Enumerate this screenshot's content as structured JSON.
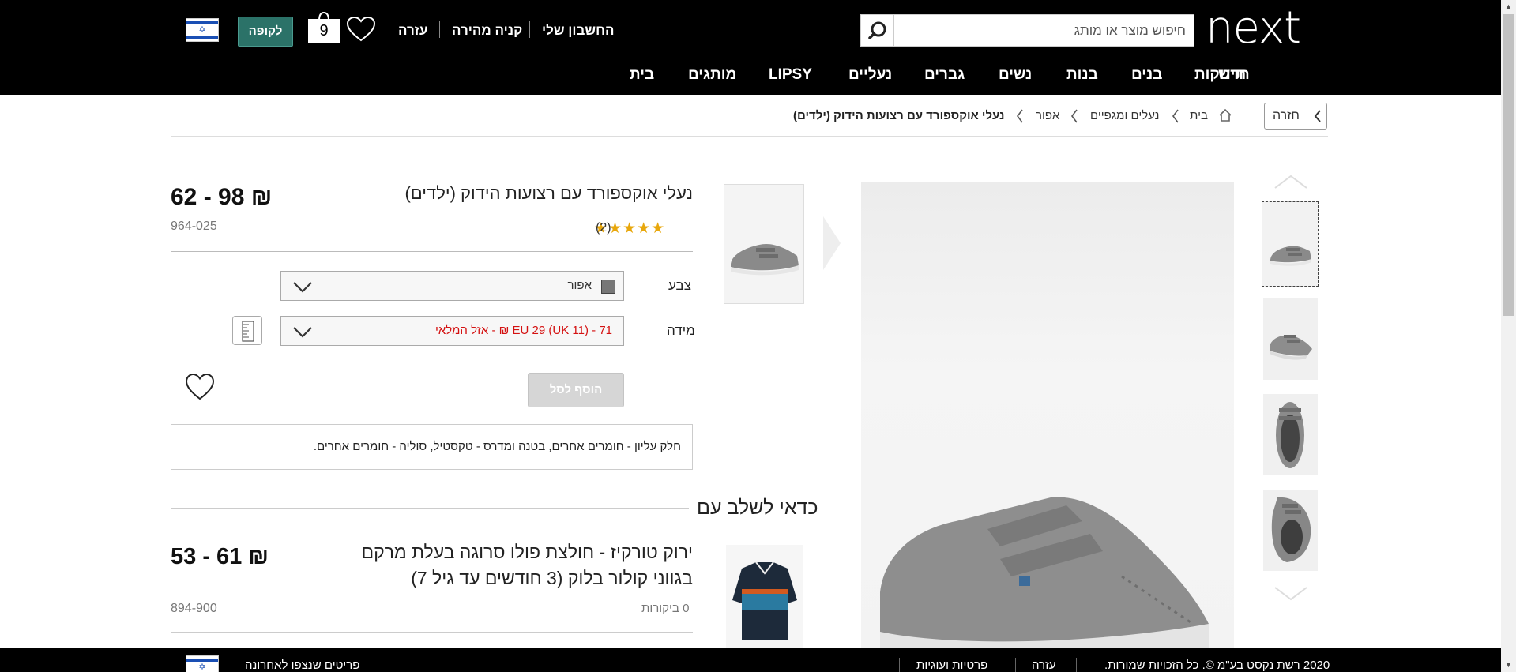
{
  "header": {
    "logo": "next",
    "search_placeholder": "חיפוש מוצר או מותג",
    "my_account": "החשבון שלי",
    "quick_buy": "קניה מהירה",
    "help": "עזרה",
    "bag_count": "9",
    "checkout": "לקופה",
    "flag_icon": "israel-flag-icon"
  },
  "nav": [
    "חדש",
    "תינוקות",
    "בנים",
    "בנות",
    "נשים",
    "גברים",
    "נעליים",
    "LIPSY",
    "מותגים",
    "בית"
  ],
  "breadcrumb": {
    "back": "חזרה",
    "items": [
      "בית",
      "נעלים ומגפיים",
      "אפור",
      "נעלי אוקספורד עם רצועות הידוק (ילדים)"
    ]
  },
  "product": {
    "title": "נעלי אוקספורד עם רצועות הידוק (ילדים)",
    "price": "62 - 98 ₪",
    "code": "964-025",
    "rating": 4.5,
    "stars": "★★★★★",
    "review_count": "(2)",
    "color_label": "צבע",
    "color_value": "אפור",
    "color_swatch": "#777777",
    "size_label": "מידה",
    "size_value": "71 - EU 29 (UK 11) ₪ - אזל המלאי",
    "add_to_bag": "הוסף לסל",
    "composition": "חלק עליון - חומרים אחרים, בטנה ומדרס - טקסטיל, סוליה - חומרים אחרים."
  },
  "related": {
    "section_title": "כדאי לשלב עם",
    "title": "ירוק טורקיז - חולצת פולו סרוגה בעלת מרקם בגווני קולור בלוק (3 חודשים עד גיל 7)",
    "price": "53 - 61 ₪",
    "code": "894-900",
    "reviews": "0 ביקורות"
  },
  "footer": {
    "recently_viewed": "פריטים שנצפו לאחרונה",
    "privacy": "פרטיות ועוגיות",
    "help": "עזרה",
    "copyright": "2020 רשת נקסט בע\"מ ©. כל הזכויות שמורות."
  },
  "colors": {
    "header_bg": "#000000",
    "checkout_bg": "#2b7268",
    "star": "#e8a70c",
    "sold_out": "#d41111"
  }
}
